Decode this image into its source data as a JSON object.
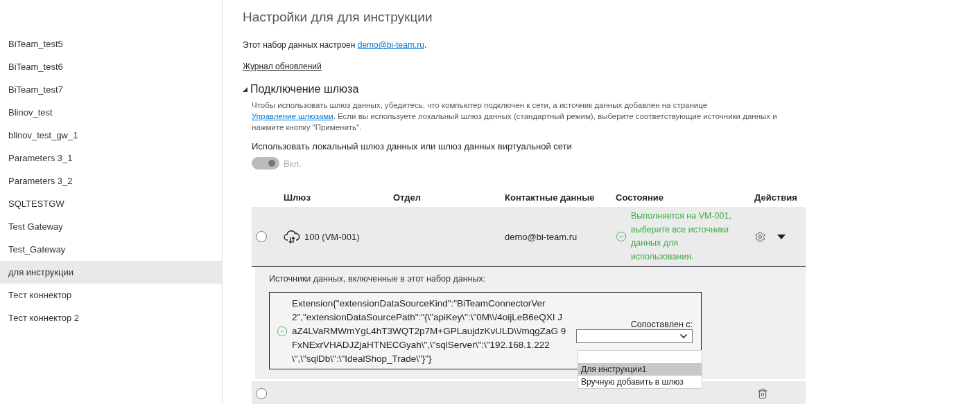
{
  "sidebar": {
    "items": [
      {
        "label": "BiTeam_test5",
        "selected": false
      },
      {
        "label": "BiTeam_test6",
        "selected": false
      },
      {
        "label": "BiTeam_test7",
        "selected": false
      },
      {
        "label": "Blinov_test",
        "selected": false
      },
      {
        "label": "blinov_test_gw_1",
        "selected": false
      },
      {
        "label": "Parameters 3_1",
        "selected": false
      },
      {
        "label": "Parameters 3_2",
        "selected": false
      },
      {
        "label": "SQLTESTGW",
        "selected": false
      },
      {
        "label": "Test Gateway",
        "selected": false
      },
      {
        "label": "Test_Gateway",
        "selected": false
      },
      {
        "label": "для инструкции",
        "selected": true
      },
      {
        "label": "Тест коннектор",
        "selected": false
      },
      {
        "label": "Тест коннектор 2",
        "selected": false
      }
    ]
  },
  "page_title": "Настройки для для инструкции",
  "configured": {
    "text": "Этот набор данных настроен ",
    "link": "demo@bi-team.ru",
    "tail": "."
  },
  "history_link": "Журнал обновлений",
  "section": {
    "title": "Подключение шлюза",
    "expanded": true,
    "description": {
      "before": "Чтобы использовать шлюз данных, убедитесь, что компьютер подключен к сети, а источник данных добавлен на странице ",
      "link": "Управление шлюзами",
      "after": ". Если вы используете локальный шлюз данных (стандартный режим), выберите соответствующие источники данных и нажмите кнопку \"Применить\"."
    },
    "toggle": {
      "label": "Использовать локальный шлюз данных или шлюз данных виртуальной сети",
      "on": true,
      "disabled": true,
      "state_text": "Вкл."
    }
  },
  "table": {
    "columns": [
      "Шлюз",
      "Отдел",
      "Контактные данные",
      "Состояние",
      "Действия"
    ],
    "rows": [
      {
        "selected": false,
        "name": "100 (VM-001)",
        "contact": "demo@bi-team.ru",
        "status": "Выполняется на VM-001, выберите все источники данных для использования.",
        "expanded": true,
        "sources_title": "Источники данных, включенные в этот набор данных:",
        "source": {
          "text": "Extension{\"extensionDataSourceKind\":\"BiTeamConnectorVer 2\",\"extensionDataSourcePath\":\"{\\\"apiKey\\\":\\\"0M\\\\/4oijLeB6eQXI JaZ4LVaRMWmYgL4hT3WQT2p7M+GPLaujdzKvULD\\\\/mqgZaG 9FxNExrVHADJZjaHTNECGyah\\\",\\\"sqlServer\\\":\\\"192.168.1.222 \\\",\\\"sqlDb\\\":\\\"IdealShop_Trade\\\"}\"}",
          "mapped_label": "Сопоставлен с:",
          "dropdown_open": true,
          "options": [
            {
              "label": "Для инструкции1",
              "selected": true
            },
            {
              "label": "Вручную добавить в шлюз",
              "selected": false
            }
          ]
        }
      },
      {
        "selected": false
      }
    ]
  }
}
